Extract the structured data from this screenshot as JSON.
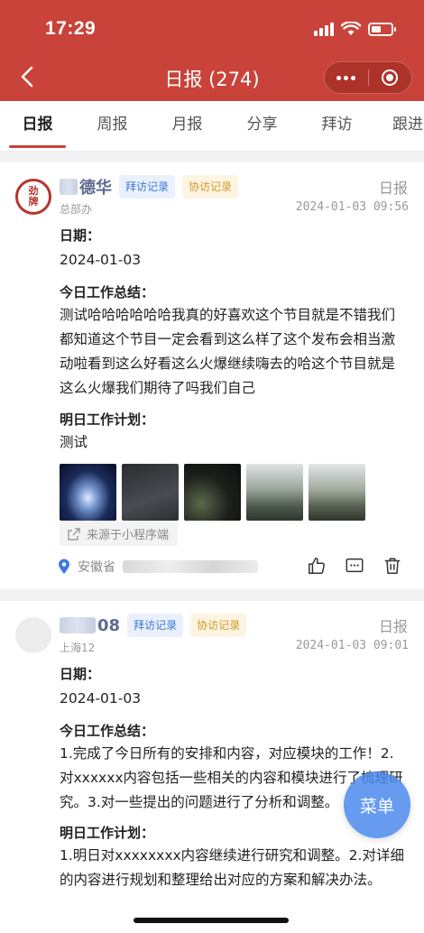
{
  "status": {
    "time": "17:29"
  },
  "nav": {
    "title": "日报 (274)"
  },
  "tabs": [
    "日报",
    "周报",
    "月报",
    "分享",
    "拜访",
    "跟进"
  ],
  "colors": {
    "header": "#c9433a",
    "accent_blue": "#3b78d8",
    "accent_yellow": "#d49a2a"
  },
  "reports": [
    {
      "avatar_text": "劲牌",
      "name_visible": "德华",
      "tag_visit": "拜访记录",
      "tag_assist": "协访记录",
      "dept": "总部办",
      "type": "日报",
      "datetime": "2024-01-03 09:56",
      "date_label": "日期：",
      "date_value": "2024-01-03",
      "summary_label": "今日工作总结：",
      "summary": "测试哈哈哈哈哈哈我真的好喜欢这个节目就是不错我们都知道这个节目一定会看到这么样了这个发布会相当激动啦看到这么好看这么火爆继续嗨去的哈这个节目就是这么火爆我们期待了吗我们自己",
      "plan_label": "明日工作计划：",
      "plan": "测试",
      "source": "来源于小程序端",
      "location": "安徽省"
    },
    {
      "name_visible": "08",
      "tag_visit": "拜访记录",
      "tag_assist": "协访记录",
      "dept": "上海12",
      "type": "日报",
      "datetime": "2024-01-03 09:01",
      "date_label": "日期：",
      "date_value": "2024-01-03",
      "summary_label": "今日工作总结：",
      "summary": "1.完成了今日所有的安排和内容，对应模块的工作！2.对xxxxxx内容包括一些相关的内容和模块进行了梳理研究。3.对一些提出的问题进行了分析和调整。",
      "plan_label": "明日工作计划：",
      "plan": "1.明日对xxxxxxxx内容继续进行研究和调整。2.对详细的内容进行规划和整理给出对应的方案和解决办法。"
    }
  ],
  "fab": {
    "label": "菜单"
  }
}
